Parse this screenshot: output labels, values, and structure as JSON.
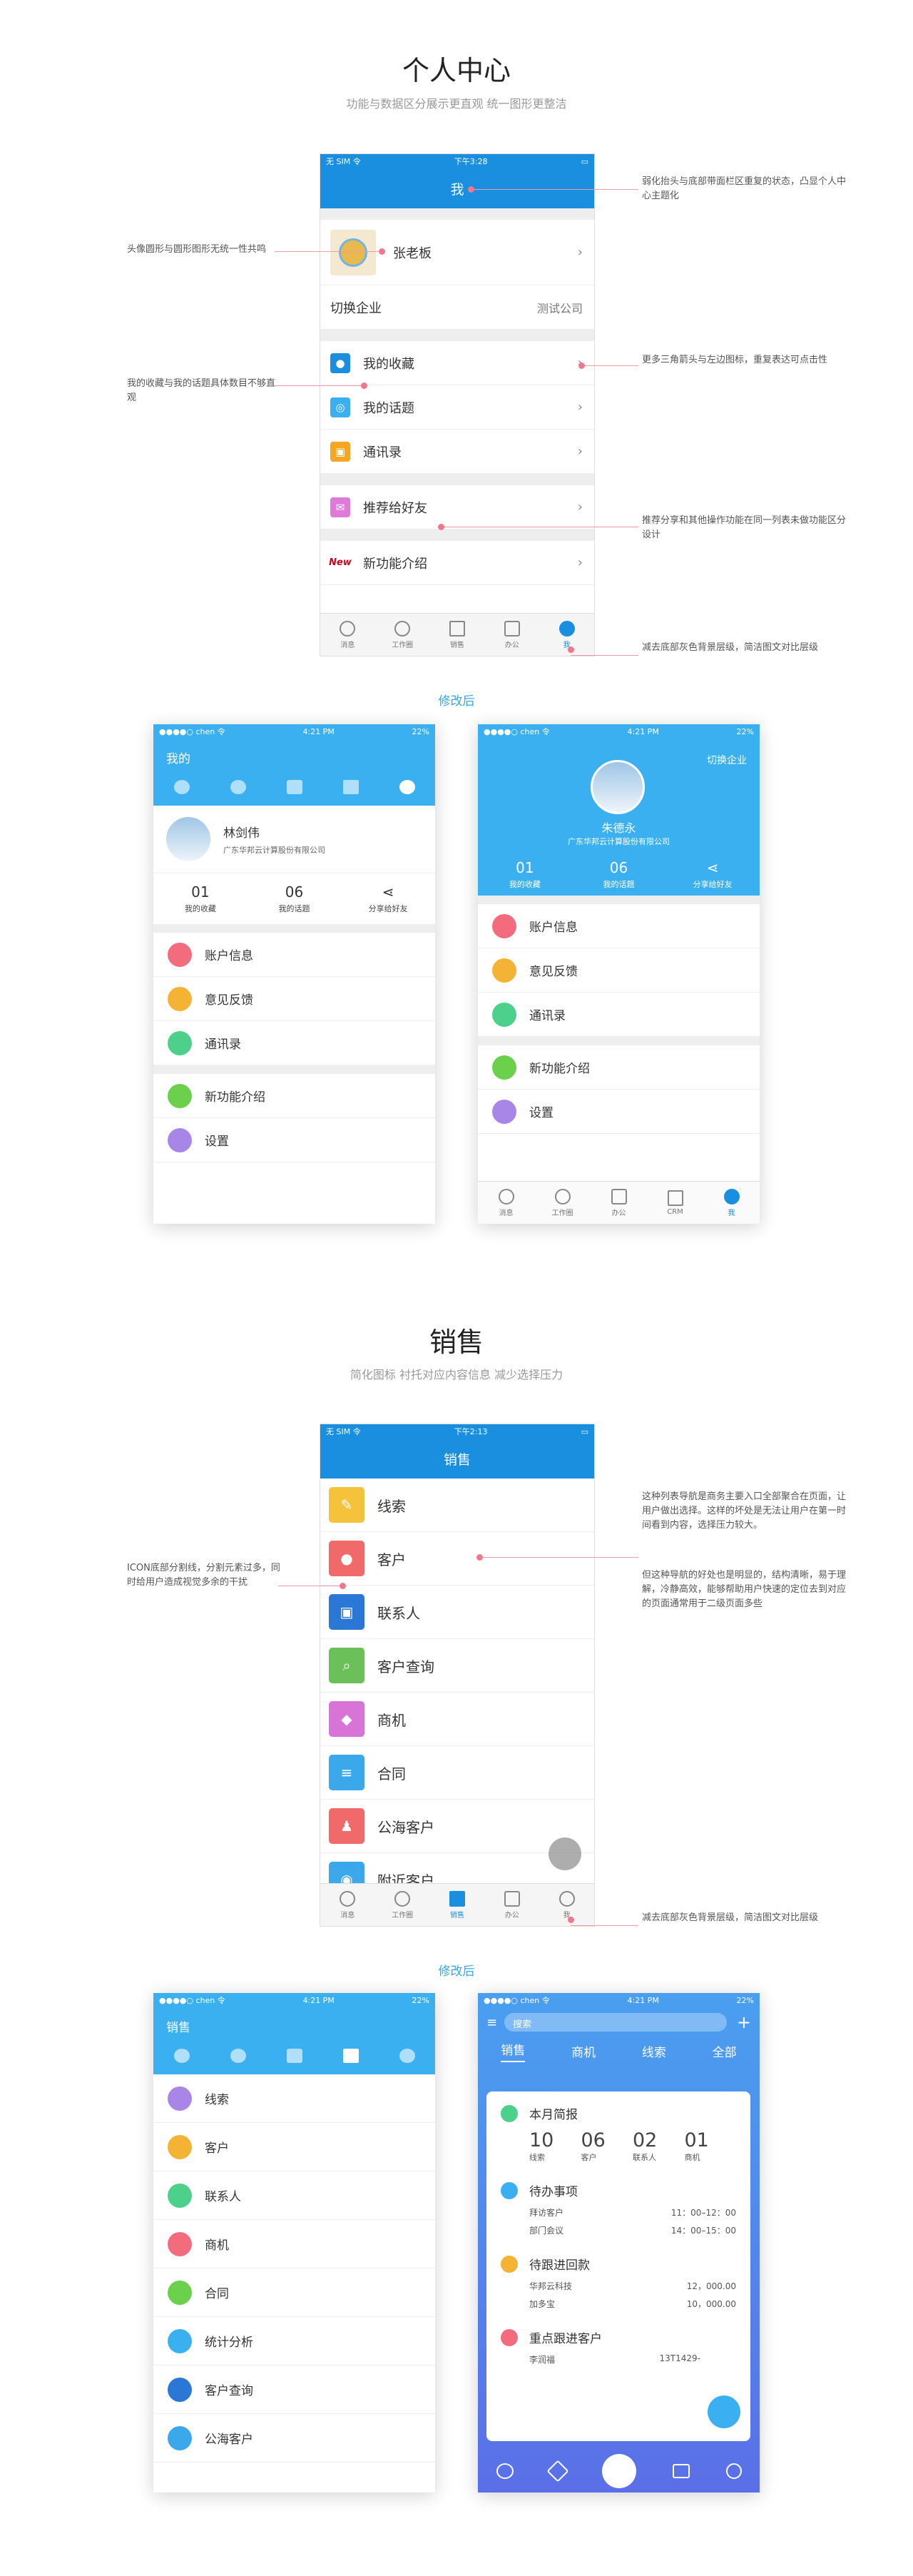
{
  "sec1": {
    "title": "个人中心",
    "subtitle": "功能与数据区分展示更直观  统一图形更整洁"
  },
  "sec2": {
    "title": "销售",
    "subtitle": "简化图标  衬托对应内容信息  减少选择压力"
  },
  "after_label": "修改后",
  "old1": {
    "status_left": "无 SIM 令",
    "status_time": "下午3:28",
    "nav_title": "我",
    "user_name": "张老板",
    "switch_label": "切换企业",
    "switch_value": "测试公司",
    "rows": [
      "我的收藏",
      "我的话题",
      "通讯录",
      "推荐给好友",
      "新功能介绍"
    ],
    "tabs": [
      "消息",
      "工作圈",
      "销售",
      "办公",
      "我"
    ]
  },
  "ann1": {
    "a1": "弱化抬头与底部带面栏区重复的状态，凸显个人中心主题化",
    "a2": "头像圆形与圆形图形无统一性共鸣",
    "a3": "更多三角箭头与左边图标，重复表达可点击性",
    "a4": "我的收藏与我的话题具体数目不够直观",
    "a5": "推荐分享和其他操作功能在同一列表未做功能区分设计",
    "a6": "减去底部灰色背景层级，简洁图文对比层级"
  },
  "new1a": {
    "status_left": "●●●●○ chen 令",
    "status_time": "4:21 PM",
    "status_right": "22%",
    "nav_title": "我的",
    "user_name": "林剑伟",
    "company": "广东华邦云计算股份有限公司",
    "stats": [
      {
        "n": "01",
        "l": "我的收藏"
      },
      {
        "n": "06",
        "l": "我的话题"
      },
      {
        "n": "",
        "l": "分享给好友"
      }
    ],
    "rows1": [
      "账户信息",
      "意见反馈",
      "通讯录"
    ],
    "rows2": [
      "新功能介绍",
      "设置"
    ]
  },
  "new1b": {
    "status_left": "●●●●○ chen 令",
    "status_time": "4:21 PM",
    "status_right": "22%",
    "switch": "切换企业",
    "user_name": "朱德永",
    "company": "广东华邦云计算股份有限公司",
    "stats": [
      {
        "n": "01",
        "l": "我的收藏"
      },
      {
        "n": "06",
        "l": "我的话题"
      },
      {
        "n": "",
        "l": "分享给好友"
      }
    ],
    "rows1": [
      "账户信息",
      "意见反馈",
      "通讯录"
    ],
    "rows2": [
      "新功能介绍",
      "设置"
    ],
    "tabs": [
      "消息",
      "工作圈",
      "办公",
      "CRM",
      "我"
    ]
  },
  "old2": {
    "status_left": "无 SIM 令",
    "status_time": "下午2:13",
    "nav_title": "销售",
    "rows": [
      "线索",
      "客户",
      "联系人",
      "客户查询",
      "商机",
      "合同",
      "公海客户",
      "附近客户"
    ],
    "tabs": [
      "消息",
      "工作圈",
      "销售",
      "办公",
      "我"
    ]
  },
  "ann2": {
    "b1": "这种列表导航是商务主要入口全部聚合在页面，让用户做出选择。这样的坏处是无法让用户在第一时间看到内容，选择压力较大。",
    "b2": "但这种导航的好处也是明显的，结构清晰，易于理解，冷静高效，能够帮助用户快速的定位去到对应的页面通常用于二级页面多些",
    "b3": "ICON底部分割线，分割元素过多，同时给用户造成视觉多余的干扰",
    "b4": "减去底部灰色背景层级，简洁图文对比层级"
  },
  "new2a": {
    "status_left": "●●●●○ chen 令",
    "status_time": "4:21 PM",
    "status_right": "22%",
    "nav_title": "销售",
    "rows": [
      "线索",
      "客户",
      "联系人",
      "商机",
      "合同",
      "统计分析",
      "客户查询",
      "公海客户"
    ]
  },
  "new2b": {
    "status_left": "●●●●○ chen 令",
    "status_time": "4:21 PM",
    "status_right": "22%",
    "search_placeholder": "搜索",
    "tabs": [
      "销售",
      "商机",
      "线索",
      "全部"
    ],
    "card1_title": "本月简报",
    "brief": [
      {
        "n": "10",
        "l": "线索"
      },
      {
        "n": "06",
        "l": "客户"
      },
      {
        "n": "02",
        "l": "联系人"
      },
      {
        "n": "01",
        "l": "商机"
      }
    ],
    "card2_title": "待办事项",
    "todo": [
      {
        "k": "拜访客户",
        "v": "11：00–12：00"
      },
      {
        "k": "部门会议",
        "v": "14：00–15：00"
      }
    ],
    "card3_title": "待跟进回款",
    "pay": [
      {
        "k": "华邦云科技",
        "v": "12，000.00"
      },
      {
        "k": "加多宝",
        "v": "10，000.00"
      }
    ],
    "card4_title": "重点跟进客户",
    "cust": {
      "k": "李润福",
      "v": "13T1429-"
    }
  },
  "colors": {
    "blue": "#1a8fe0",
    "lightblue": "#3bb0f0",
    "pink": "#f0788c"
  }
}
